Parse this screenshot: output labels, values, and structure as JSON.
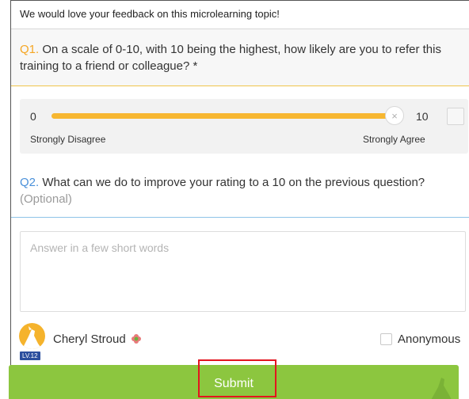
{
  "header": {
    "title": "We would love your feedback on this microlearning topic!"
  },
  "questions": [
    {
      "number": "Q1.",
      "text": "On a scale of 0-10, with 10 being the highest, how likely are you to refer this training to a friend or colleague? *"
    },
    {
      "number": "Q2.",
      "text": "What can we do to improve your rating to a 10 on the previous question?",
      "optional": "(Optional)"
    }
  ],
  "scale": {
    "min": "0",
    "max": "10",
    "value": 10,
    "thumb_symbol": "×",
    "low_label": "Strongly Disagree",
    "high_label": "Strongly Agree",
    "fill_color": "#f7b731"
  },
  "answer": {
    "placeholder": "Answer in a few short words",
    "value": ""
  },
  "user": {
    "name": "Cheryl Stroud",
    "level": "LV.12",
    "avatar_icon": "user-avatar-icon",
    "badge_icon": "flower-badge-icon"
  },
  "anonymous": {
    "label": "Anonymous",
    "checked": false
  },
  "submit": {
    "label": "Submit",
    "color": "#8cc63f",
    "highlight_color": "#e3141f"
  }
}
